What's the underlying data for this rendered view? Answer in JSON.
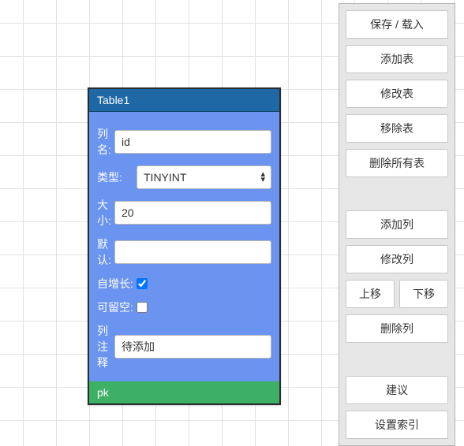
{
  "table": {
    "title": "Table1",
    "fields": {
      "col_name_label": "列名:",
      "col_name_value": "id",
      "type_label": "类型:",
      "type_value": "TINYINT",
      "size_label": "大小:",
      "size_value": "20",
      "default_label": "默认:",
      "default_value": "",
      "autoincr_label": "自增长:",
      "autoincr_checked": true,
      "nullable_label": "可留空:",
      "nullable_checked": false,
      "remark_label": "列注释",
      "remark_value": "待添加"
    },
    "footer": "pk"
  },
  "panel": {
    "group1": {
      "save_load": "保存 / 载入",
      "add_table": "添加表",
      "edit_table": "修改表",
      "remove_table": "移除表",
      "delete_all_tables": "删除所有表"
    },
    "group2": {
      "add_col": "添加列",
      "edit_col": "修改列",
      "move_up": "上移",
      "move_down": "下移",
      "delete_col": "删除列"
    },
    "group3": {
      "suggest": "建议",
      "set_index": "设置索引"
    }
  }
}
